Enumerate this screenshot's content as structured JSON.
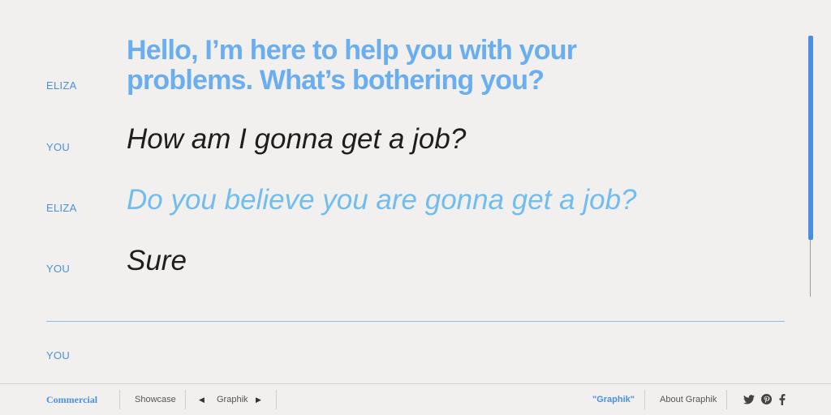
{
  "conversation": [
    {
      "speaker": "ELIZA",
      "text": "Hello, I’m here to help you with your problems. What’s bothering you?"
    },
    {
      "speaker": "YOU",
      "text": "How am I gonna get a job?"
    },
    {
      "speaker": "ELIZA",
      "text": "Do you believe you are gonna get a job?"
    },
    {
      "speaker": "YOU",
      "text": "Sure"
    }
  ],
  "input": {
    "speaker": "YOU",
    "value": "",
    "placeholder": ""
  },
  "footer": {
    "brand": "Commercial",
    "showcase": "Showcase",
    "typeface": "Graphik",
    "current": "\"Graphik\"",
    "about": "About Graphik",
    "social": [
      "twitter-icon",
      "pinterest-icon",
      "facebook-icon"
    ]
  },
  "colors": {
    "accent": "#4a90e2",
    "eliza_text": "#71bdf0",
    "user_text": "#1e1e1e",
    "background": "#f1f0ee"
  }
}
